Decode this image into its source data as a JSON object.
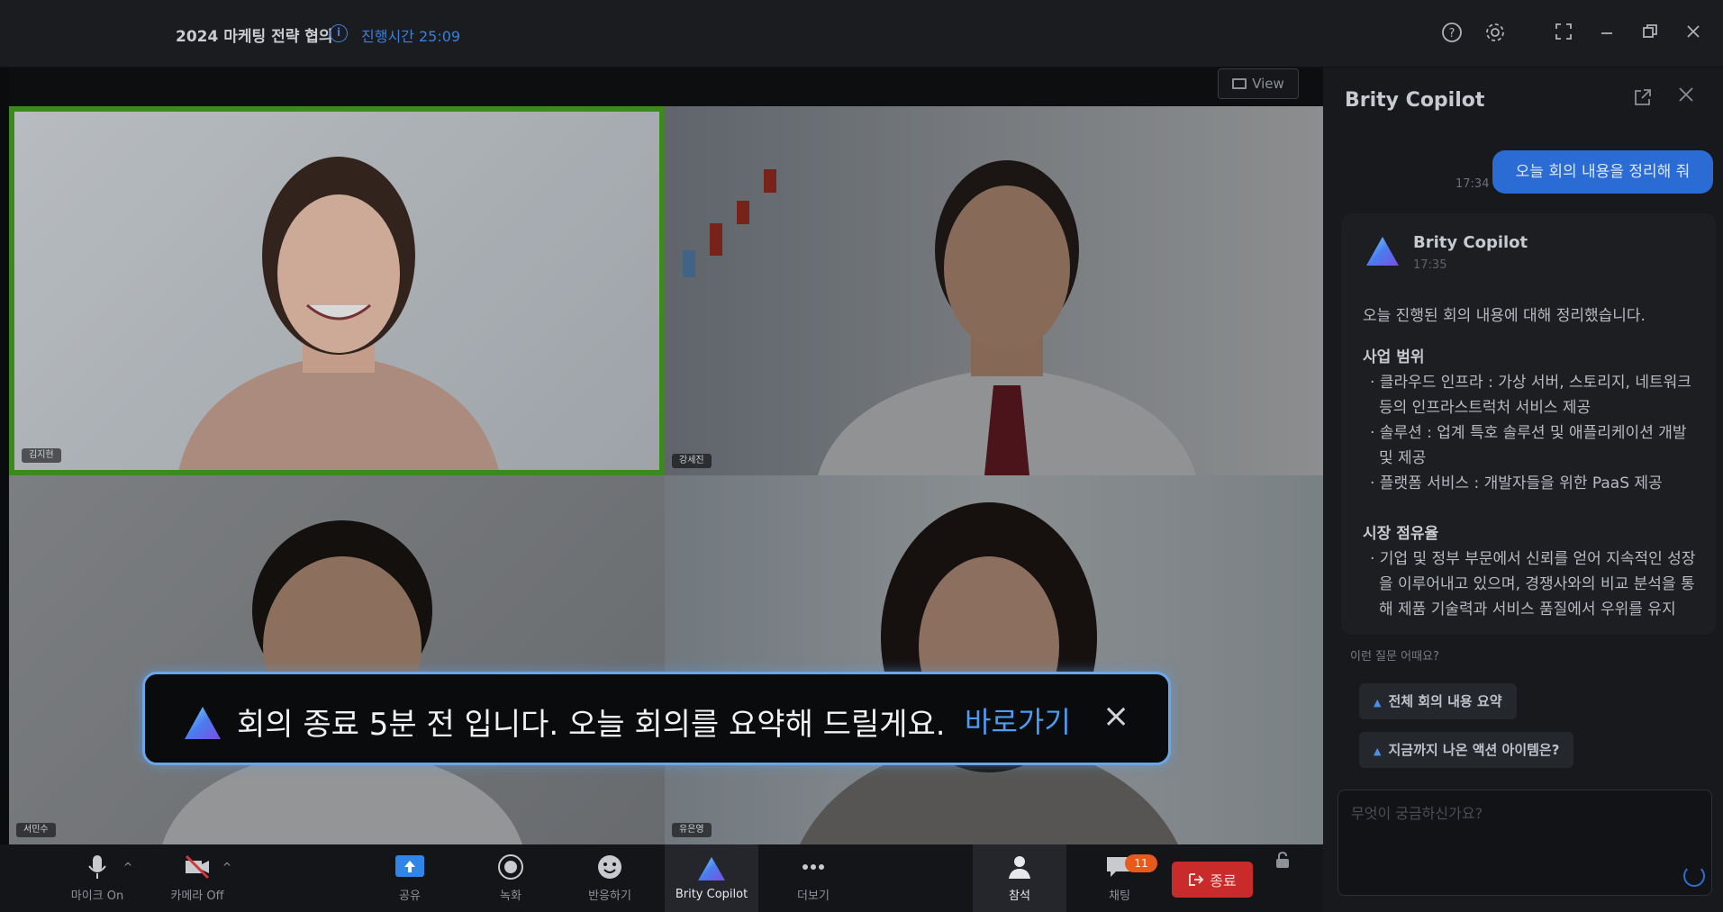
{
  "window": {
    "title": "2024 마케팅 전략 협의",
    "elapsed": "진행시간 25:09",
    "info_icon": "info-icon",
    "controls": [
      "help-icon",
      "settings-icon",
      "fullscreen-icon",
      "minimize-icon",
      "restore-icon",
      "close-icon"
    ]
  },
  "stage": {
    "view_label": "View",
    "participants": [
      {
        "name": "김지현",
        "active_speaker": true
      },
      {
        "name": "강세진",
        "active_speaker": false
      },
      {
        "name": "서민수",
        "active_speaker": false
      },
      {
        "name": "유은영",
        "active_speaker": false
      }
    ]
  },
  "toast": {
    "message": "회의 종료 5분 전 입니다. 오늘 회의를 요약해 드릴게요.",
    "action": "바로가기",
    "close": "×"
  },
  "toolbar": {
    "mic": "마이크 On",
    "camera": "카메라 Off",
    "share": "공유",
    "record": "녹화",
    "reaction": "반응하기",
    "copilot": "Brity Copilot",
    "more": "더보기",
    "participants": "참석",
    "chat": "채팅",
    "chat_badge": "11",
    "end": "종료"
  },
  "panel": {
    "title": "Brity Copilot",
    "user_message": "오늘 회의 내용을 정리해 줘",
    "user_time": "17:34",
    "bot_name": "Brity Copilot",
    "bot_time": "17:35",
    "intro": "오늘 진행된 회의 내용에 대해 정리했습니다.",
    "section1_title": "사업 범위",
    "section1_items": [
      "· 클라우드 인프라 : 가상 서버, 스토리지, 네트워크 등의 인프라스트럭처 서비스 제공",
      "· 솔루션 : 업계 특호 솔루션 및 애플리케이션 개발 및 제공",
      "· 플랫폼 서비스 : 개발자들을 위한 PaaS 제공"
    ],
    "section2_title": "시장 점유율",
    "section2_items": [
      "· 기업 및 정부 부문에서 신뢰를 얻어 지속적인 성장을 이루어내고 있으며, 경쟁사와의 비교 분석을 통해 제품 기술력과 서비스 품질에서 우위를 유지"
    ],
    "suggest_label": "이런 질문 어때요?",
    "suggestions": [
      "전체 회의 내용 요약",
      "지금까지 나온 액션 아이템은?"
    ],
    "input_placeholder": "무엇이 궁금하신가요?"
  },
  "colors": {
    "accent": "#2b6bd4",
    "active_border": "#3a8a1e",
    "end_button": "#c92a2a",
    "badge": "#e8591c"
  }
}
